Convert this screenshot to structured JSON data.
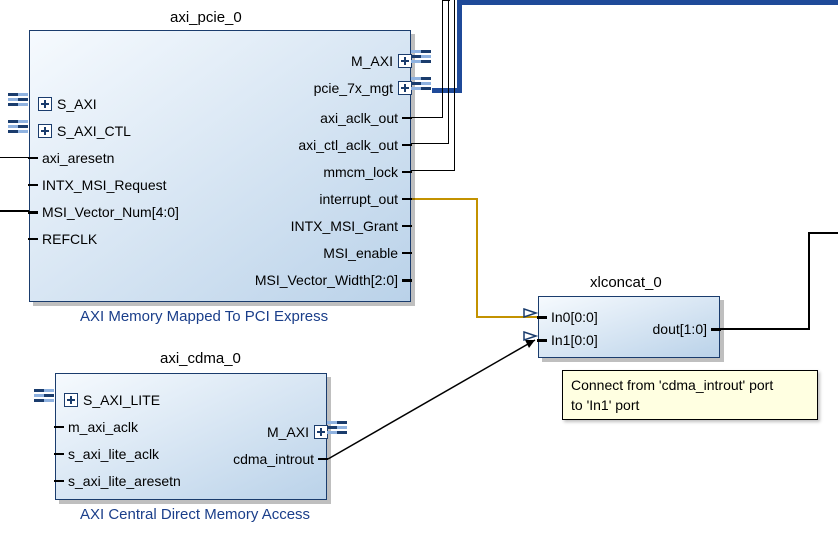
{
  "blocks": {
    "pcie": {
      "inst": "axi_pcie_0",
      "desc": "AXI Memory Mapped To PCI Express",
      "left_ports": [
        {
          "name": "S_AXI",
          "expandable": true,
          "bus": true,
          "key": "s_axi"
        },
        {
          "name": "S_AXI_CTL",
          "expandable": true,
          "bus": true,
          "key": "s_axi_ctl"
        },
        {
          "name": "axi_aresetn",
          "key": "axi_aresetn"
        },
        {
          "name": "INTX_MSI_Request",
          "key": "intx_msi_request"
        },
        {
          "name": "MSI_Vector_Num[4:0]",
          "key": "msi_vector_num"
        },
        {
          "name": "REFCLK",
          "key": "refclk"
        }
      ],
      "right_ports": [
        {
          "name": "M_AXI",
          "expandable": true,
          "bus": true,
          "key": "m_axi"
        },
        {
          "name": "pcie_7x_mgt",
          "expandable": true,
          "bus": true,
          "key": "pcie_7x_mgt"
        },
        {
          "name": "axi_aclk_out",
          "key": "axi_aclk_out"
        },
        {
          "name": "axi_ctl_aclk_out",
          "key": "axi_ctl_aclk_out"
        },
        {
          "name": "mmcm_lock",
          "key": "mmcm_lock"
        },
        {
          "name": "interrupt_out",
          "key": "interrupt_out"
        },
        {
          "name": "INTX_MSI_Grant",
          "key": "intx_msi_grant"
        },
        {
          "name": "MSI_enable",
          "key": "msi_enable"
        },
        {
          "name": "MSI_Vector_Width[2:0]",
          "key": "msi_vector_width"
        }
      ]
    },
    "cdma": {
      "inst": "axi_cdma_0",
      "desc": "AXI Central Direct Memory Access",
      "left_ports": [
        {
          "name": "S_AXI_LITE",
          "expandable": true,
          "bus": true,
          "key": "s_axi_lite"
        },
        {
          "name": "m_axi_aclk",
          "key": "m_axi_aclk"
        },
        {
          "name": "s_axi_lite_aclk",
          "key": "s_axi_lite_aclk"
        },
        {
          "name": "s_axi_lite_aresetn",
          "key": "s_axi_lite_aresetn"
        }
      ],
      "right_ports": [
        {
          "name": "M_AXI",
          "expandable": true,
          "bus": true,
          "key": "m_axi"
        },
        {
          "name": "cdma_introut",
          "key": "cdma_introut"
        }
      ]
    },
    "xlconcat": {
      "inst": "xlconcat_0",
      "left_ports": [
        {
          "name": "In0[0:0]",
          "key": "in0"
        },
        {
          "name": "In1[0:0]",
          "key": "in1"
        }
      ],
      "right_ports": [
        {
          "name": "dout[1:0]",
          "key": "dout"
        }
      ]
    }
  },
  "tooltip": {
    "line1": "Connect from 'cdma_introut' port",
    "line2": "to 'In1' port"
  },
  "connections": [
    {
      "from": "axi_pcie_0.interrupt_out",
      "to": "xlconcat_0.In0[0:0]",
      "color": "gold"
    },
    {
      "from": "axi_cdma_0.cdma_introut",
      "to": "xlconcat_0.In1[0:0]",
      "color": "black",
      "pending": true
    },
    {
      "from": "axi_pcie_0.pcie_7x_mgt",
      "to": "external",
      "color": "blue",
      "bus": true
    },
    {
      "from": "axi_pcie_0.axi_aclk_out",
      "to": "external",
      "color": "black"
    },
    {
      "from": "axi_pcie_0.axi_ctl_aclk_out",
      "to": "external",
      "color": "black"
    },
    {
      "from": "axi_pcie_0.mmcm_lock",
      "to": "external",
      "color": "black"
    },
    {
      "from": "xlconcat_0.dout[1:0]",
      "to": "external",
      "color": "black"
    },
    {
      "from": "external",
      "to": "axi_pcie_0.axi_aresetn",
      "color": "black"
    },
    {
      "from": "external",
      "to": "axi_pcie_0.MSI_Vector_Num[4:0]",
      "color": "black"
    }
  ]
}
